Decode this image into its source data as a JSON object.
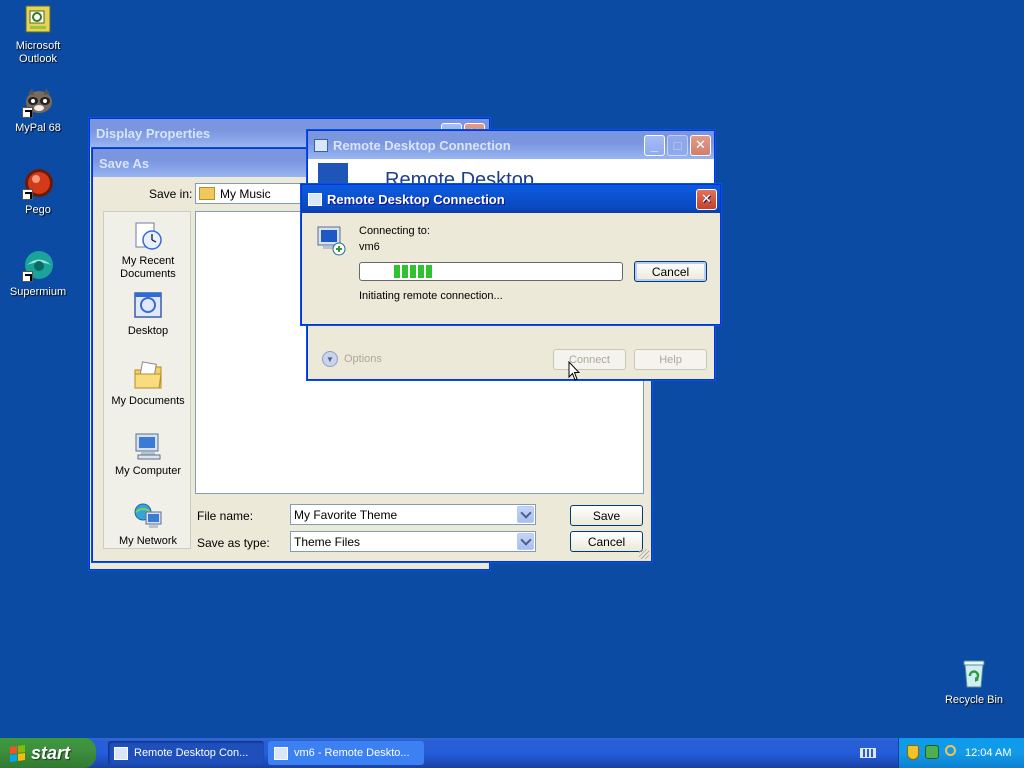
{
  "desktop": {
    "icons": [
      {
        "label": "Microsoft Outlook"
      },
      {
        "label": "MyPal 68"
      },
      {
        "label": "Pego"
      },
      {
        "label": "Supermium"
      },
      {
        "label": "Recycle Bin"
      }
    ]
  },
  "display_properties": {
    "title": "Display Properties"
  },
  "save_as": {
    "title": "Save As",
    "save_in_label": "Save in:",
    "save_in_value": "My Music",
    "places": [
      {
        "label": "My Recent Documents"
      },
      {
        "label": "Desktop"
      },
      {
        "label": "My Documents"
      },
      {
        "label": "My Computer"
      },
      {
        "label": "My Network"
      }
    ],
    "file_name_label": "File name:",
    "file_name_value": "My Favorite Theme",
    "save_as_type_label": "Save as type:",
    "save_as_type_value": "Theme Files",
    "save_label": "Save",
    "cancel_label": "Cancel"
  },
  "rdc_main": {
    "title": "Remote Desktop Connection",
    "banner_text": "Remote Desktop",
    "options_label": "Options",
    "connect_label": "Connect",
    "help_label": "Help"
  },
  "rdc_connecting": {
    "title": "Remote Desktop Connection",
    "connecting_to_label": "Connecting to:",
    "host": "vm6",
    "progress_blocks": 5,
    "status_text": "Initiating remote connection...",
    "cancel_label": "Cancel"
  },
  "taskbar": {
    "start_label": "start",
    "tasks": [
      {
        "label": "Remote Desktop Con..."
      },
      {
        "label": "vm6 - Remote Deskto..."
      }
    ],
    "clock": "12:04 AM"
  },
  "colors": {
    "desktop_bg": "#0c4ba3",
    "progress_green": "#2fc32f",
    "title_active": "#0a5ae0"
  }
}
